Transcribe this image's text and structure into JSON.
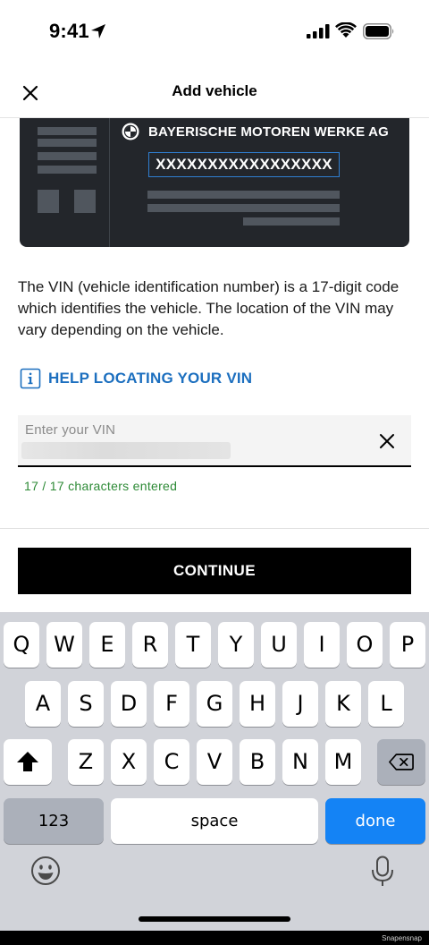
{
  "status_bar": {
    "time": "9:41"
  },
  "nav": {
    "title": "Add vehicle"
  },
  "vin_card": {
    "manufacturer": "BAYERISCHE MOTOREN WERKE AG",
    "vin_example": "XXXXXXXXXXXXXXXXX"
  },
  "description": "The VIN (vehicle identification number) is a 17-digit code which identifies the vehicle. The location of the VIN may vary depending on the vehicle.",
  "help_link": {
    "label": "HELP LOCATING YOUR VIN"
  },
  "vin_input": {
    "placeholder": "Enter your VIN",
    "value": "",
    "counter": "17 / 17 characters entered"
  },
  "continue_button": {
    "label": "CONTINUE"
  },
  "keyboard": {
    "row1": [
      "Q",
      "W",
      "E",
      "R",
      "T",
      "Y",
      "U",
      "I",
      "O",
      "P"
    ],
    "row2": [
      "A",
      "S",
      "D",
      "F",
      "G",
      "H",
      "J",
      "K",
      "L"
    ],
    "row3": [
      "Z",
      "X",
      "C",
      "V",
      "B",
      "N",
      "M"
    ],
    "numbers_key": "123",
    "space_key": "space",
    "done_key": "done"
  },
  "watermark": "Snapensnap",
  "colors": {
    "link_blue": "#1c6fbf",
    "success_green": "#2d8a36",
    "done_blue": "#1483f5",
    "card_bg": "#23262b"
  }
}
